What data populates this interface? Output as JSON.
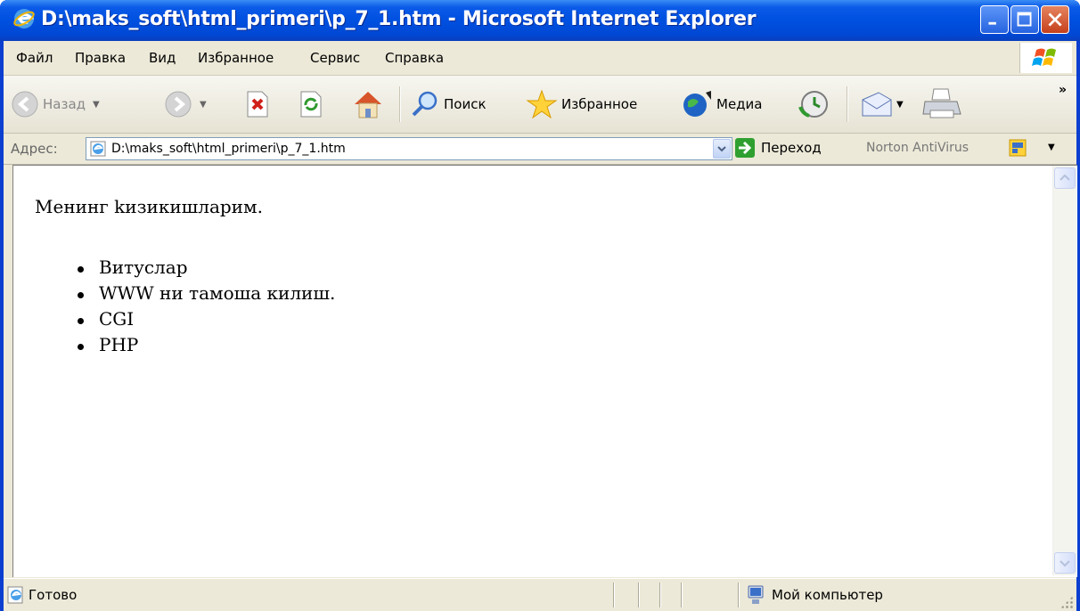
{
  "window": {
    "title": "D:\\maks_soft\\html_primeri\\p_7_1.htm - Microsoft Internet Explorer"
  },
  "menu": [
    "Файл",
    "Правка",
    "Вид",
    "Избранное",
    "Сервис",
    "Справка"
  ],
  "toolbar": {
    "back_label": "Назад",
    "search_label": "Поиск",
    "favorites_label": "Избранное",
    "media_label": "Медиа",
    "chevron": "»"
  },
  "address": {
    "label": "Адрес:",
    "url": "D:\\maks_soft\\html_primeri\\p_7_1.htm",
    "go_label": "Переход",
    "norton_label": "Norton AntiVirus"
  },
  "page": {
    "paragraph": "Менинг kизикишларим.",
    "list": [
      "Витуслар",
      "WWW ни тамоша килиш.",
      "CGI",
      "PHP"
    ]
  },
  "status": {
    "text": "Готово",
    "zone": "Мой компьютер"
  },
  "colors": {
    "titlebar": "#0050e0",
    "chrome": "#ece9d8",
    "close_button": "#c6401c"
  },
  "icons": [
    "ie-icon",
    "minimize-icon",
    "maximize-icon",
    "close-icon",
    "windows-flag-icon",
    "back-icon",
    "forward-icon",
    "stop-icon",
    "refresh-icon",
    "home-icon",
    "search-icon",
    "favorites-star-icon",
    "media-icon",
    "history-icon",
    "mail-icon",
    "print-icon",
    "go-arrow-icon",
    "norton-icon",
    "my-computer-icon"
  ]
}
